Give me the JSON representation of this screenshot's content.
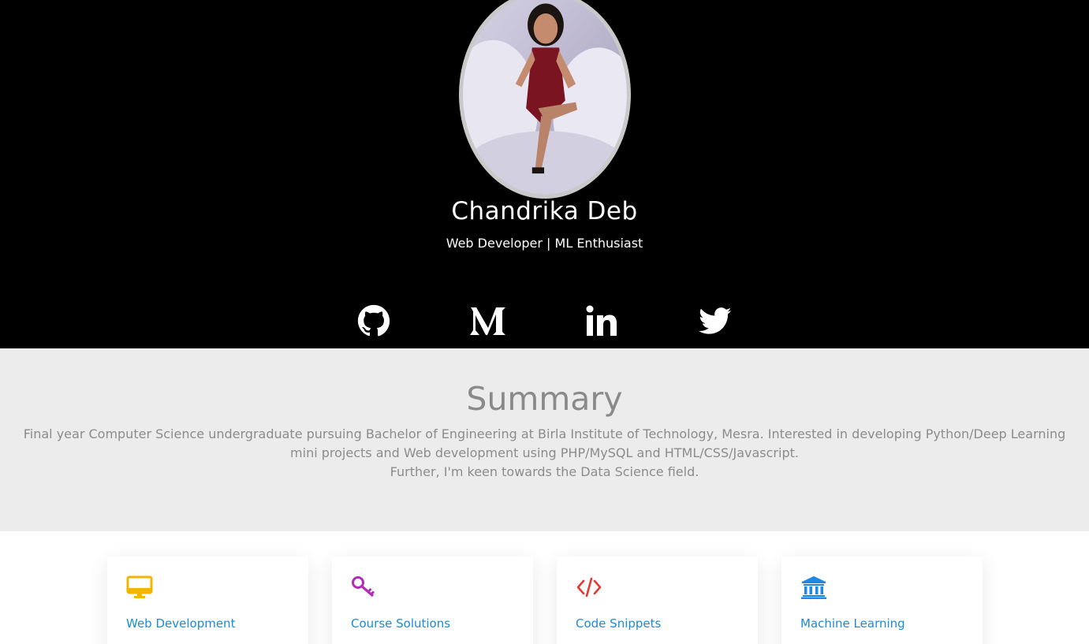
{
  "hero": {
    "name": "Chandrika Deb",
    "tagline": "Web Developer | ML Enthusiast",
    "avatar_icon": "profile-photo",
    "social": [
      {
        "name": "github",
        "icon": "github-icon"
      },
      {
        "name": "medium",
        "icon": "medium-icon"
      },
      {
        "name": "linkedin",
        "icon": "linkedin-icon"
      },
      {
        "name": "twitter",
        "icon": "twitter-icon"
      }
    ],
    "colors": {
      "background": "#000000",
      "text": "#ffffff"
    }
  },
  "summary": {
    "title": "Summary",
    "line1": "Final year Computer Science undergraduate pursuing Bachelor of Engineering at Birla Institute of Technology, Mesra. Interested in developing Python/Deep Learning",
    "line2": "mini projects and Web development using PHP/MySQL and HTML/CSS/Javascript.",
    "line3": "Further, I'm keen towards the Data Science field.",
    "colors": {
      "background": "#ececec",
      "text": "#8a8a8a"
    }
  },
  "cards": [
    {
      "title": "Web Development",
      "icon": "monitor-icon",
      "color": "#f4b400"
    },
    {
      "title": "Course Solutions",
      "icon": "key-icon",
      "color": "#b02fb8"
    },
    {
      "title": "Code Snippets",
      "icon": "code-icon",
      "color": "#e53935"
    },
    {
      "title": "Machine Learning",
      "icon": "institution-icon",
      "color": "#1e88e5"
    }
  ],
  "card_title_color": "#1a8cd8"
}
